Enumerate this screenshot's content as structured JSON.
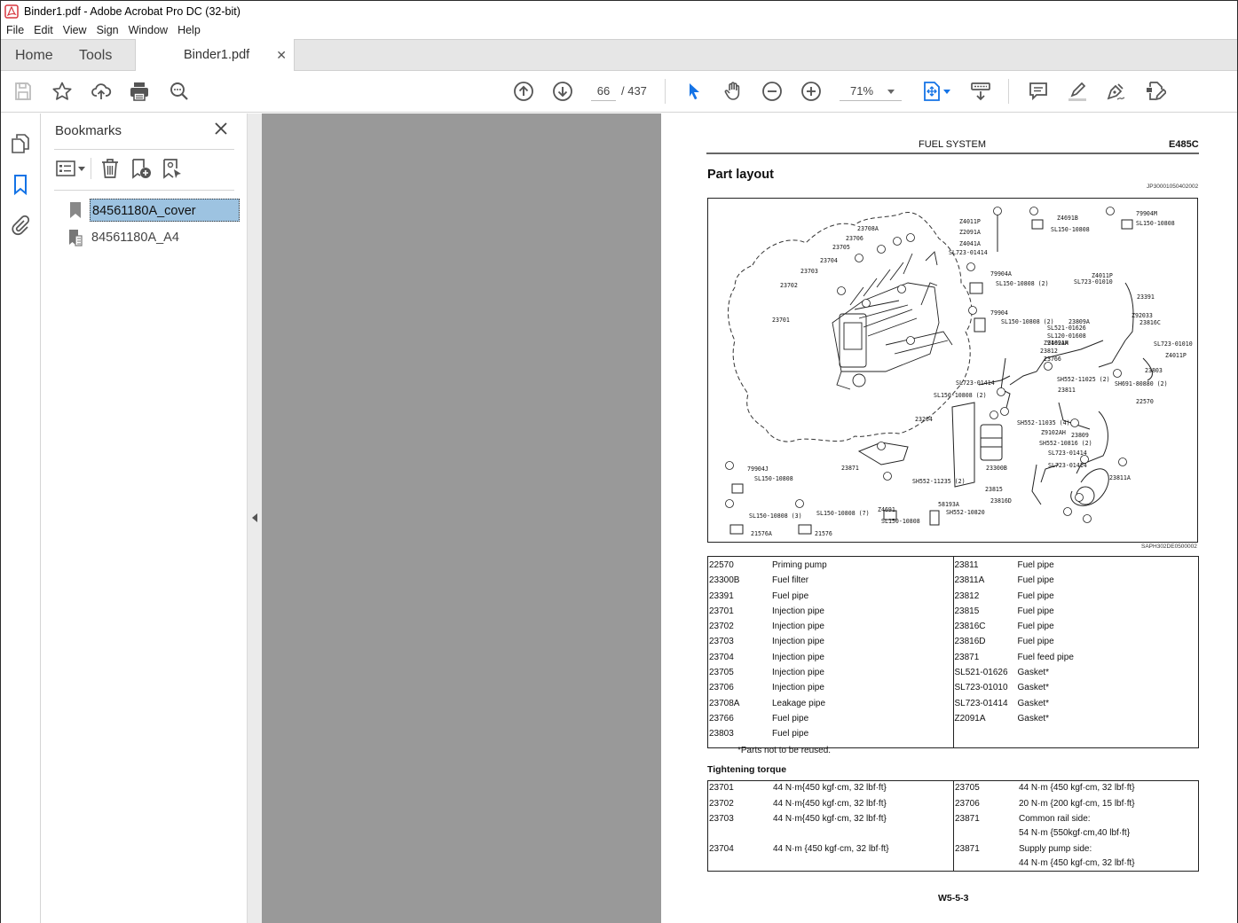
{
  "window": {
    "title": "Binder1.pdf - Adobe Acrobat Pro DC (32-bit)",
    "app_icon": "acrobat-icon"
  },
  "menu": [
    "File",
    "Edit",
    "View",
    "Sign",
    "Window",
    "Help"
  ],
  "tabs": {
    "home": "Home",
    "tools": "Tools",
    "document": "Binder1.pdf",
    "close_icon": "close-icon"
  },
  "toolbar": {
    "left_icons": [
      "save-icon",
      "bookmark-star-icon",
      "upload-cloud-icon",
      "print-icon",
      "search-zoom-icon"
    ],
    "current_page": "66",
    "page_total": "/ 437",
    "zoom": "71%",
    "nav_icons": [
      "page-up-icon",
      "page-down-icon"
    ],
    "tools_icons": [
      "select-cursor-icon",
      "hand-icon",
      "zoom-out-icon",
      "zoom-in-icon",
      "fit-page-icon",
      "scroll-mode-icon",
      "comment-icon",
      "highlight-icon",
      "sign-icon",
      "edit-pdf-icon"
    ],
    "accent_color": "#1473e6"
  },
  "sidebar_rail": [
    "page-thumbnails-icon",
    "bookmarks-icon",
    "attachments-icon"
  ],
  "bookmarks": {
    "title": "Bookmarks",
    "tools": [
      "options-menu-icon",
      "delete-bookmark-icon",
      "new-bookmark-icon",
      "bookmark-from-structure-icon"
    ],
    "items": [
      {
        "label": "84561180A_cover",
        "icon": "bookmark-icon",
        "selected": true
      },
      {
        "label": "84561180A_A4",
        "icon": "bookmark-tagged-icon",
        "selected": false
      }
    ],
    "selection_color": "#9dc3e1"
  },
  "page": {
    "header_title": "FUEL SYSTEM",
    "header_code": "E485C",
    "section_title": "Part layout",
    "doc_id": "JP30001050402002",
    "figure_id": "SAPH302DE0500002",
    "figure_labels": {
      "engine": [
        "23708A",
        "23706",
        "23705",
        "23704",
        "23703",
        "23702",
        "23701"
      ],
      "detail_a": [
        "Z4011P",
        "Z2091A",
        "Z4041A",
        "SL723-01414"
      ],
      "detail_b": [
        "Z4691B",
        "SL150-10808"
      ],
      "detail_c": [
        "79904M",
        "SL150-10808"
      ],
      "detail_d": [
        "79904A",
        "SL150-10808 (2)"
      ],
      "detail_e": [
        "79904",
        "SL150-10808 (2)"
      ],
      "detail_f": [
        "79904J",
        "SL150-10808"
      ],
      "detail_g": [
        "SL150-10808 (3)",
        "21576A"
      ],
      "detail_h": [
        "SL150-10808 (7)",
        "21576"
      ],
      "misc": [
        "Z4691",
        "SL150-10808",
        "58193A",
        "SH552-10820",
        "23871",
        "23264",
        "SL150-10808 (2)",
        "SH552-11235 (2)"
      ],
      "pipes": [
        "Z4011P",
        "SL723-01010",
        "23391",
        "Z92033",
        "23816C",
        "23809A",
        "SL521-01626",
        "SL120-01608",
        "Z4691A",
        "Z9102AH",
        "23812",
        "23766",
        "SL723-01010",
        "Z4011P",
        "23803",
        "SH691-80880 (2)",
        "SH552-11025 (2)",
        "23811",
        "SL723-01414",
        "22570",
        "23809",
        "SH552-10816 (2)",
        "SH552-11035 (4)",
        "Z9102AH",
        "SL723-01414",
        "SL723-01414",
        "23300B",
        "23815",
        "23816D",
        "23811A"
      ]
    },
    "parts_left": [
      {
        "no": "22570",
        "name": "Priming pump"
      },
      {
        "no": "23300B",
        "name": "Fuel filter"
      },
      {
        "no": "23391",
        "name": "Fuel pipe"
      },
      {
        "no": "23701",
        "name": "Injection pipe"
      },
      {
        "no": "23702",
        "name": "Injection pipe"
      },
      {
        "no": "23703",
        "name": "Injection pipe"
      },
      {
        "no": "23704",
        "name": "Injection pipe"
      },
      {
        "no": "23705",
        "name": "Injection pipe"
      },
      {
        "no": "23706",
        "name": "Injection pipe"
      },
      {
        "no": "23708A",
        "name": "Leakage pipe"
      },
      {
        "no": "23766",
        "name": "Fuel pipe"
      },
      {
        "no": "23803",
        "name": "Fuel pipe"
      }
    ],
    "parts_right": [
      {
        "no": "23811",
        "name": "Fuel pipe"
      },
      {
        "no": "23811A",
        "name": "Fuel pipe"
      },
      {
        "no": "23812",
        "name": "Fuel pipe"
      },
      {
        "no": "23815",
        "name": "Fuel pipe"
      },
      {
        "no": "23816C",
        "name": "Fuel pipe"
      },
      {
        "no": "23816D",
        "name": "Fuel pipe"
      },
      {
        "no": "23871",
        "name": "Fuel feed pipe"
      },
      {
        "no": "SL521-01626",
        "name": "Gasket*"
      },
      {
        "no": "SL723-01010",
        "name": "Gasket*"
      },
      {
        "no": "SL723-01414",
        "name": "Gasket*"
      },
      {
        "no": "Z2091A",
        "name": "Gasket*"
      }
    ],
    "note": "*Parts not to be reused.",
    "torque_title": "Tightening torque",
    "torque_left": [
      {
        "no": "23701",
        "val": "44 N·m{450 kgf·cm, 32 lbf·ft}"
      },
      {
        "no": "23702",
        "val": "44 N·m{450 kgf·cm, 32 lbf·ft}"
      },
      {
        "no": "23703",
        "val": "44 N·m{450 kgf·cm, 32 lbf·ft}"
      },
      {
        "no": "23704",
        "val": "44 N·m {450 kgf·cm, 32 lbf·ft}"
      }
    ],
    "torque_right": [
      {
        "no": "23705",
        "val": "44 N·m {450 kgf·cm, 32 lbf·ft}"
      },
      {
        "no": "23706",
        "val": "20 N·m {200 kgf·cm, 15 lbf·ft}"
      },
      {
        "no": "23871",
        "val": "Common rail side:",
        "val2": "54 N·m {550kgf·cm,40 lbf·ft}"
      },
      {
        "no": "23871",
        "val": "Supply pump side:",
        "val2": "44 N·m {450 kgf·cm, 32 lbf·ft}"
      }
    ],
    "page_number": "W5-5-3"
  }
}
